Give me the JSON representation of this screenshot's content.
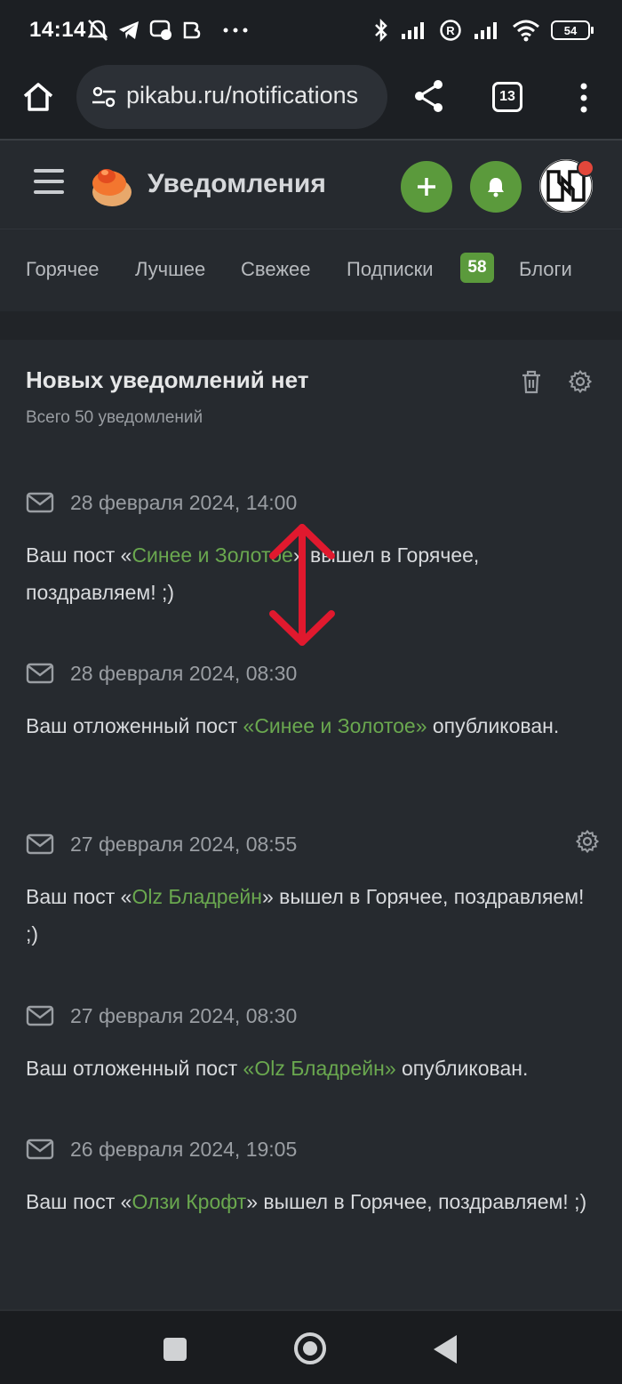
{
  "status_bar": {
    "time": "14:14",
    "battery": "54",
    "icons": [
      "mute-icon",
      "telegram-icon",
      "chat-icon",
      "app-icon",
      "more-dots-icon",
      "bluetooth-icon",
      "signal-icon",
      "roaming-icon",
      "signal-icon",
      "wifi-icon",
      "battery-icon"
    ]
  },
  "browser": {
    "url": "pikabu.ru/notifications",
    "tab_count": "13"
  },
  "header": {
    "title": "Уведомления"
  },
  "nav": {
    "tabs": [
      "Горячее",
      "Лучшее",
      "Свежее",
      "Подписки",
      "Блоги"
    ],
    "subscriptions_badge": "58"
  },
  "content": {
    "title": "Новых уведомлений нет",
    "subtitle": "Всего 50 уведомлений"
  },
  "notifications": [
    {
      "date": "28 февраля 2024, 14:00",
      "pre": "Ваш пост «",
      "link": "Синее и Золотое",
      "post": "» вышел в Горячее, поздравляем! ;)"
    },
    {
      "date": "28 февраля 2024, 08:30",
      "pre": "Ваш отложенный пост ",
      "link": "«Синее и Золотое»",
      "post": " опубликован."
    },
    {
      "date": "27 февраля 2024, 08:55",
      "pre": "Ваш пост «",
      "link": "Olz Бладрейн",
      "post": "» вышел в Горячее, поздравляем! ;)"
    },
    {
      "date": "27 февраля 2024, 08:30",
      "pre": "Ваш отложенный пост ",
      "link": "«Olz Бладрейн»",
      "post": " опубликован."
    },
    {
      "date": "26 февраля 2024, 19:05",
      "pre": "Ваш пост «",
      "link": "Олзи Крофт",
      "post": "» вышел в Горячее, поздравляем! ;)"
    }
  ],
  "colors": {
    "accent_green": "#5b9a3c",
    "link_green": "#6aa84f",
    "arrow_red": "#e0192e",
    "background": "#262a2f"
  }
}
